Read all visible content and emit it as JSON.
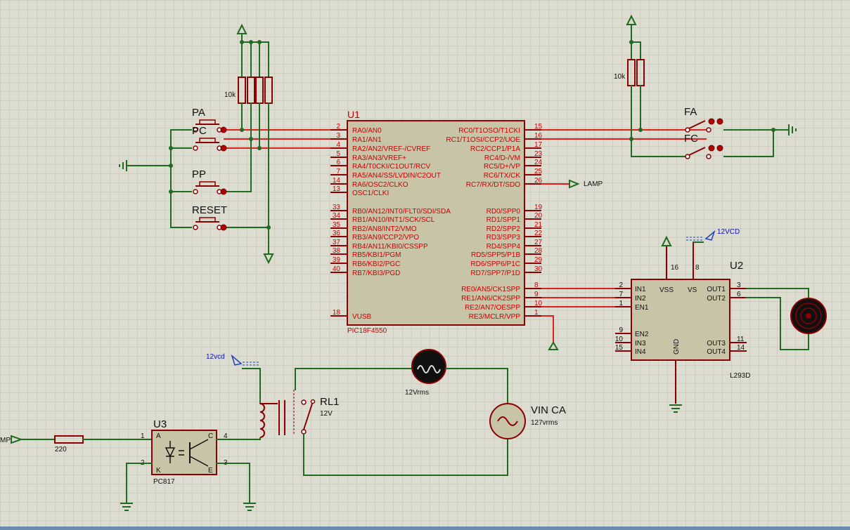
{
  "u1": {
    "ref": "U1",
    "part": "PIC18F4550",
    "left_pins": [
      {
        "num": "2",
        "name": "RA0/AN0"
      },
      {
        "num": "3",
        "name": "RA1/AN1"
      },
      {
        "num": "4",
        "name": "RA2/AN2/VREF-/CVREF"
      },
      {
        "num": "5",
        "name": "RA3/AN3/VREF+"
      },
      {
        "num": "6",
        "name": "RA4/T0CKI/C1OUT/RCV"
      },
      {
        "num": "7",
        "name": "RA5/AN4/SS/LVDIN/C2OUT"
      },
      {
        "num": "14",
        "name": "RA6/OSC2/CLKO"
      },
      {
        "num": "13",
        "name": "OSC1/CLKI"
      },
      {
        "num": "33",
        "name": "RB0/AN12/INT0/FLT0/SDI/SDA"
      },
      {
        "num": "34",
        "name": "RB1/AN10/INT1/SCK/SCL"
      },
      {
        "num": "35",
        "name": "RB2/AN8/INT2/VMO"
      },
      {
        "num": "36",
        "name": "RB3/AN9/CCP2/VPO"
      },
      {
        "num": "37",
        "name": "RB4/AN11/KBI0/CSSPP"
      },
      {
        "num": "38",
        "name": "RB5/KBI1/PGM"
      },
      {
        "num": "39",
        "name": "RB6/KBI2/PGC"
      },
      {
        "num": "40",
        "name": "RB7/KBI3/PGD"
      },
      {
        "num": "18",
        "name": "VUSB"
      }
    ],
    "right_pins": [
      {
        "num": "15",
        "name": "RC0/T1OSO/T1CKI"
      },
      {
        "num": "16",
        "name": "RC1/T1OSI/CCP2/UOE"
      },
      {
        "num": "17",
        "name": "RC2/CCP1/P1A"
      },
      {
        "num": "23",
        "name": "RC4/D-/VM"
      },
      {
        "num": "24",
        "name": "RC5/D+/VP"
      },
      {
        "num": "25",
        "name": "RC6/TX/CK"
      },
      {
        "num": "26",
        "name": "RC7/RX/DT/SDO"
      },
      {
        "num": "19",
        "name": "RD0/SPP0"
      },
      {
        "num": "20",
        "name": "RD1/SPP1"
      },
      {
        "num": "21",
        "name": "RD2/SPP2"
      },
      {
        "num": "22",
        "name": "RD3/SPP3"
      },
      {
        "num": "27",
        "name": "RD4/SPP4"
      },
      {
        "num": "28",
        "name": "RD5/SPP5/P1B"
      },
      {
        "num": "29",
        "name": "RD6/SPP6/P1C"
      },
      {
        "num": "30",
        "name": "RD7/SPP7/P1D"
      },
      {
        "num": "8",
        "name": "RE0/AN5/CK1SPP"
      },
      {
        "num": "9",
        "name": "RE1/AN6/CK2SPP"
      },
      {
        "num": "10",
        "name": "RE2/AN7/OESPP"
      },
      {
        "num": "1",
        "name": "RE3/MCLR/VPP"
      }
    ]
  },
  "u2": {
    "ref": "U2",
    "part": "L293D",
    "in_pins": [
      {
        "num": "2",
        "name": "IN1"
      },
      {
        "num": "7",
        "name": "IN2"
      },
      {
        "num": "1",
        "name": "EN1"
      },
      {
        "num": "9",
        "name": "EN2"
      },
      {
        "num": "10",
        "name": "IN3"
      },
      {
        "num": "15",
        "name": "IN4"
      }
    ],
    "out_pins": [
      {
        "num": "3",
        "name": "OUT1"
      },
      {
        "num": "6",
        "name": "OUT2"
      },
      {
        "num": "11",
        "name": "OUT3"
      },
      {
        "num": "14",
        "name": "OUT4"
      }
    ],
    "top_pins": [
      {
        "num": "16",
        "name": "VSS"
      },
      {
        "num": "8",
        "name": "VS"
      }
    ],
    "gnd_label": "GND",
    "supply_label": "12VCD"
  },
  "u3": {
    "ref": "U3",
    "part": "PC817",
    "pin1": "1",
    "pin2": "2",
    "pin3": "3",
    "pin4": "4",
    "label_a": "A",
    "label_k": "K",
    "label_c": "C",
    "label_e": "E"
  },
  "buttons": [
    {
      "label": "PA"
    },
    {
      "label": "PC"
    },
    {
      "label": "PP"
    },
    {
      "label": "RESET"
    }
  ],
  "limit_switches": [
    {
      "label": "FA"
    },
    {
      "label": "FC"
    }
  ],
  "resistors": {
    "pullup_left": "10k",
    "pullup_right": "10k",
    "opto": "220"
  },
  "lamp_net": "LAMP",
  "lamp_net_left": "MP",
  "relay": {
    "ref": "RL1",
    "value": "12V",
    "supply_label": "12vcd"
  },
  "lamp": {
    "value": "12Vrms"
  },
  "source": {
    "ref": "VIN CA",
    "value": "127vrms"
  }
}
